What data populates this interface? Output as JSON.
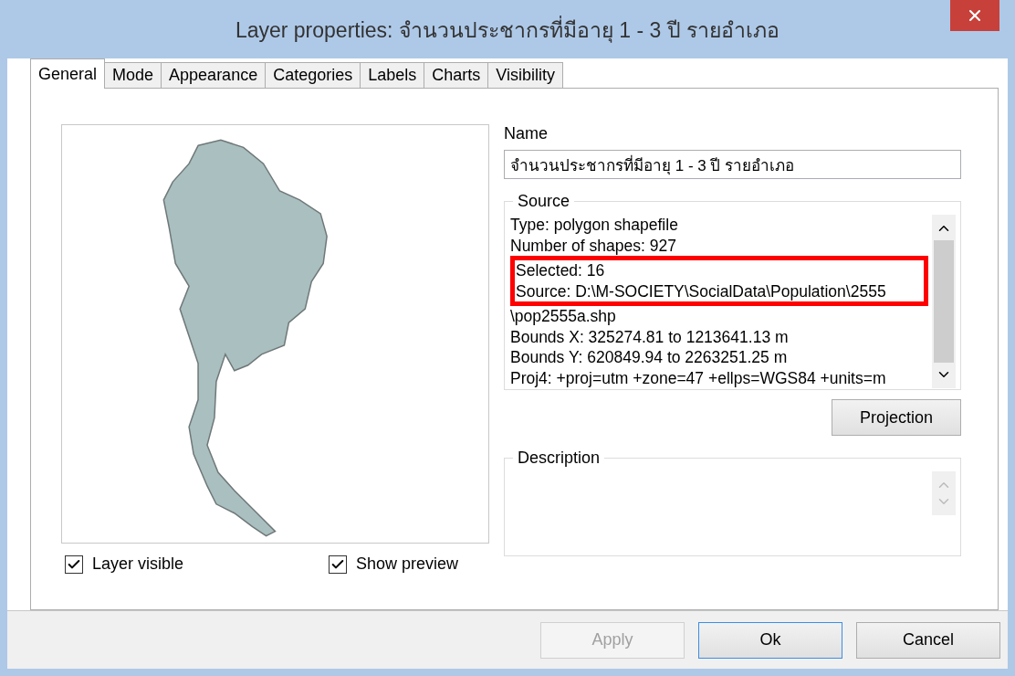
{
  "window": {
    "title": "Layer properties: จำนวนประชากรที่มีอายุ 1 - 3 ปี รายอำเภอ"
  },
  "tabs": [
    {
      "label": "General",
      "selected": true
    },
    {
      "label": "Mode",
      "selected": false
    },
    {
      "label": "Appearance",
      "selected": false
    },
    {
      "label": "Categories",
      "selected": false
    },
    {
      "label": "Labels",
      "selected": false
    },
    {
      "label": "Charts",
      "selected": false
    },
    {
      "label": "Visibility",
      "selected": false
    }
  ],
  "preview": {
    "checkboxes": [
      {
        "label": "Layer visible",
        "checked": true
      },
      {
        "label": "Show preview",
        "checked": true
      }
    ]
  },
  "name": {
    "label": "Name",
    "value": "จำนวนประชากรที่มีอายุ 1 - 3 ปี รายอำเภอ"
  },
  "source": {
    "title": "Source",
    "lines": [
      {
        "text": "Type: polygon shapefile",
        "highlighted": false
      },
      {
        "text": "Number of shapes: 927",
        "highlighted": false
      },
      {
        "text": "Selected: 16",
        "highlighted": true
      },
      {
        "text": "Source: D:\\M-SOCIETY\\SocialData\\Population\\2555",
        "highlighted": true
      },
      {
        "text": "\\pop2555a.shp",
        "highlighted": false
      },
      {
        "text": "Bounds X: 325274.81 to 1213641.13 m",
        "highlighted": false
      },
      {
        "text": "Bounds Y: 620849.94 to 2263251.25 m",
        "highlighted": false
      },
      {
        "text": "Proj4: +proj=utm +zone=47 +ellps=WGS84 +units=m",
        "highlighted": false
      }
    ]
  },
  "projection_button": "Projection",
  "description": {
    "title": "Description"
  },
  "buttons": [
    {
      "label": "Apply",
      "disabled": true,
      "default": false
    },
    {
      "label": "Ok",
      "disabled": false,
      "default": true
    },
    {
      "label": "Cancel",
      "disabled": false,
      "default": false
    }
  ]
}
